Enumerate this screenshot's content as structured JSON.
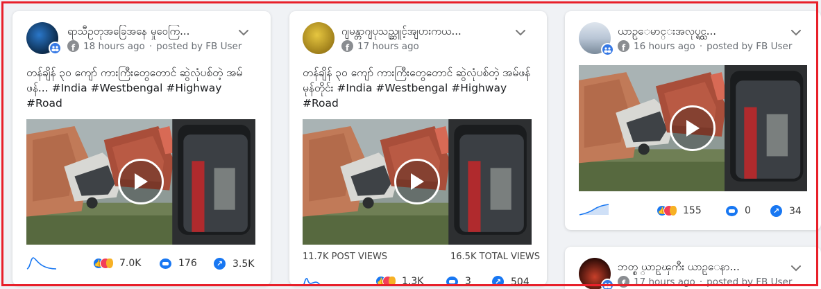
{
  "posts": [
    {
      "page_name": "ရာသီဥတုအခြေအနေ မှုဝေကြ...",
      "time": "18 hours ago",
      "posted_by": "posted by FB User",
      "text": "တန်ချိန် ၃၀ ကျော် ကားကြီးတွေတောင် ဆွဲလုံပစ်တဲ့ အမ်ဖန်... #India #Westbengal #Highway #Road",
      "reactions": "7.0K",
      "comments": "176",
      "shares": "3.5K"
    },
    {
      "page_name": "ဂျမန္တာဂျပုသည္ဆူင့်အျပားကယ...",
      "time": "17 hours ago",
      "posted_by": "",
      "text": "တန်ချိန် ၃၀ ကျော် ကားကြီးတွေတောင် ဆွဲလုံပစ်တဲ့ အမ်ဖန်မုန်တိုင်း #India #Westbengal #Highway #Road",
      "post_views": "11.7K POST VIEWS",
      "total_views": "16.5K TOTAL VIEWS",
      "reactions": "1.3K",
      "comments": "3",
      "shares": "504"
    },
    {
      "page_name": "ယာဥ္ေမာင္းအလုပ္ရွင္သ...",
      "time": "16 hours ago",
      "posted_by": "posted by FB User",
      "reactions": "155",
      "comments": "0",
      "shares": "34"
    },
    {
      "page_name": "ဘတ္စ္ ယာဥ္ၾကီး ယာဥ္ေနာ...",
      "time": "17 hours ago",
      "posted_by": "posted by FB User"
    }
  ],
  "icons": {
    "reaction": "like-love-haha-reactions-icon",
    "comment": "comment-icon",
    "share": "share-icon",
    "trend": "sparkline-trend-icon",
    "platform": "facebook-icon",
    "more": "chevron-down-icon",
    "play": "play-icon"
  },
  "colors": {
    "facebook_blue": "#1877f2",
    "frame_red": "#e8202a",
    "background": "#f0f2f5"
  }
}
